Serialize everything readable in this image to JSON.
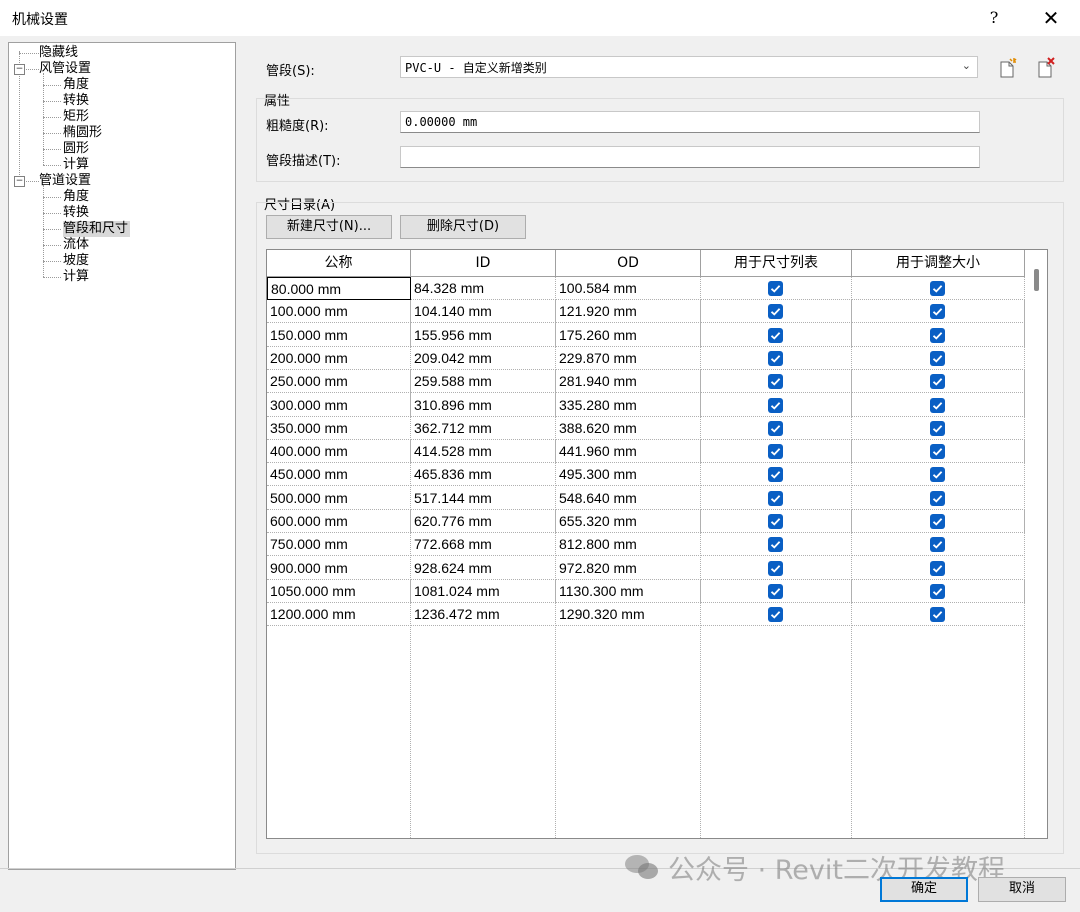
{
  "window": {
    "title": "机械设置",
    "help": "?",
    "close": "✕"
  },
  "tree": [
    {
      "label": "隐藏线"
    },
    {
      "label": "风管设置"
    },
    {
      "label": "角度"
    },
    {
      "label": "转换"
    },
    {
      "label": "矩形"
    },
    {
      "label": "椭圆形"
    },
    {
      "label": "圆形"
    },
    {
      "label": "计算"
    },
    {
      "label": "管道设置"
    },
    {
      "label": "角度"
    },
    {
      "label": "转换"
    },
    {
      "label": "管段和尺寸"
    },
    {
      "label": "流体"
    },
    {
      "label": "坡度"
    },
    {
      "label": "计算"
    }
  ],
  "tree_expander": "−",
  "segment": {
    "label": "管段(S):",
    "value": "PVC-U - 自定义新增类别"
  },
  "properties": {
    "title": "属性",
    "roughness_label": "粗糙度(R):",
    "roughness_value": "0.00000 mm",
    "description_label": "管段描述(T):",
    "description_value": ""
  },
  "size_catalog": {
    "title": "尺寸目录(A)",
    "new_button": "新建尺寸(N)...",
    "delete_button": "删除尺寸(D)",
    "columns": [
      "公称",
      "ID",
      "OD",
      "用于尺寸列表",
      "用于调整大小"
    ],
    "rows": [
      {
        "nominal": "80.000 mm",
        "id": "84.328 mm",
        "od": "100.584 mm",
        "list": true,
        "resize": true
      },
      {
        "nominal": "100.000 mm",
        "id": "104.140 mm",
        "od": "121.920 mm",
        "list": true,
        "resize": true
      },
      {
        "nominal": "150.000 mm",
        "id": "155.956 mm",
        "od": "175.260 mm",
        "list": true,
        "resize": true
      },
      {
        "nominal": "200.000 mm",
        "id": "209.042 mm",
        "od": "229.870 mm",
        "list": true,
        "resize": true
      },
      {
        "nominal": "250.000 mm",
        "id": "259.588 mm",
        "od": "281.940 mm",
        "list": true,
        "resize": true
      },
      {
        "nominal": "300.000 mm",
        "id": "310.896 mm",
        "od": "335.280 mm",
        "list": true,
        "resize": true
      },
      {
        "nominal": "350.000 mm",
        "id": "362.712 mm",
        "od": "388.620 mm",
        "list": true,
        "resize": true
      },
      {
        "nominal": "400.000 mm",
        "id": "414.528 mm",
        "od": "441.960 mm",
        "list": true,
        "resize": true
      },
      {
        "nominal": "450.000 mm",
        "id": "465.836 mm",
        "od": "495.300 mm",
        "list": true,
        "resize": true
      },
      {
        "nominal": "500.000 mm",
        "id": "517.144 mm",
        "od": "548.640 mm",
        "list": true,
        "resize": true
      },
      {
        "nominal": "600.000 mm",
        "id": "620.776 mm",
        "od": "655.320 mm",
        "list": true,
        "resize": true
      },
      {
        "nominal": "750.000 mm",
        "id": "772.668 mm",
        "od": "812.800 mm",
        "list": true,
        "resize": true
      },
      {
        "nominal": "900.000 mm",
        "id": "928.624 mm",
        "od": "972.820 mm",
        "list": true,
        "resize": true
      },
      {
        "nominal": "1050.000 mm",
        "id": "1081.024 mm",
        "od": "1130.300 mm",
        "list": true,
        "resize": true
      },
      {
        "nominal": "1200.000 mm",
        "id": "1236.472 mm",
        "od": "1290.320 mm",
        "list": true,
        "resize": true
      }
    ]
  },
  "footer": {
    "ok": "确定",
    "cancel": "取消"
  },
  "watermark": "公众号 · Revit二次开发教程",
  "colors": {
    "accent": "#0a5fc4",
    "primary_border": "#0078d7"
  }
}
